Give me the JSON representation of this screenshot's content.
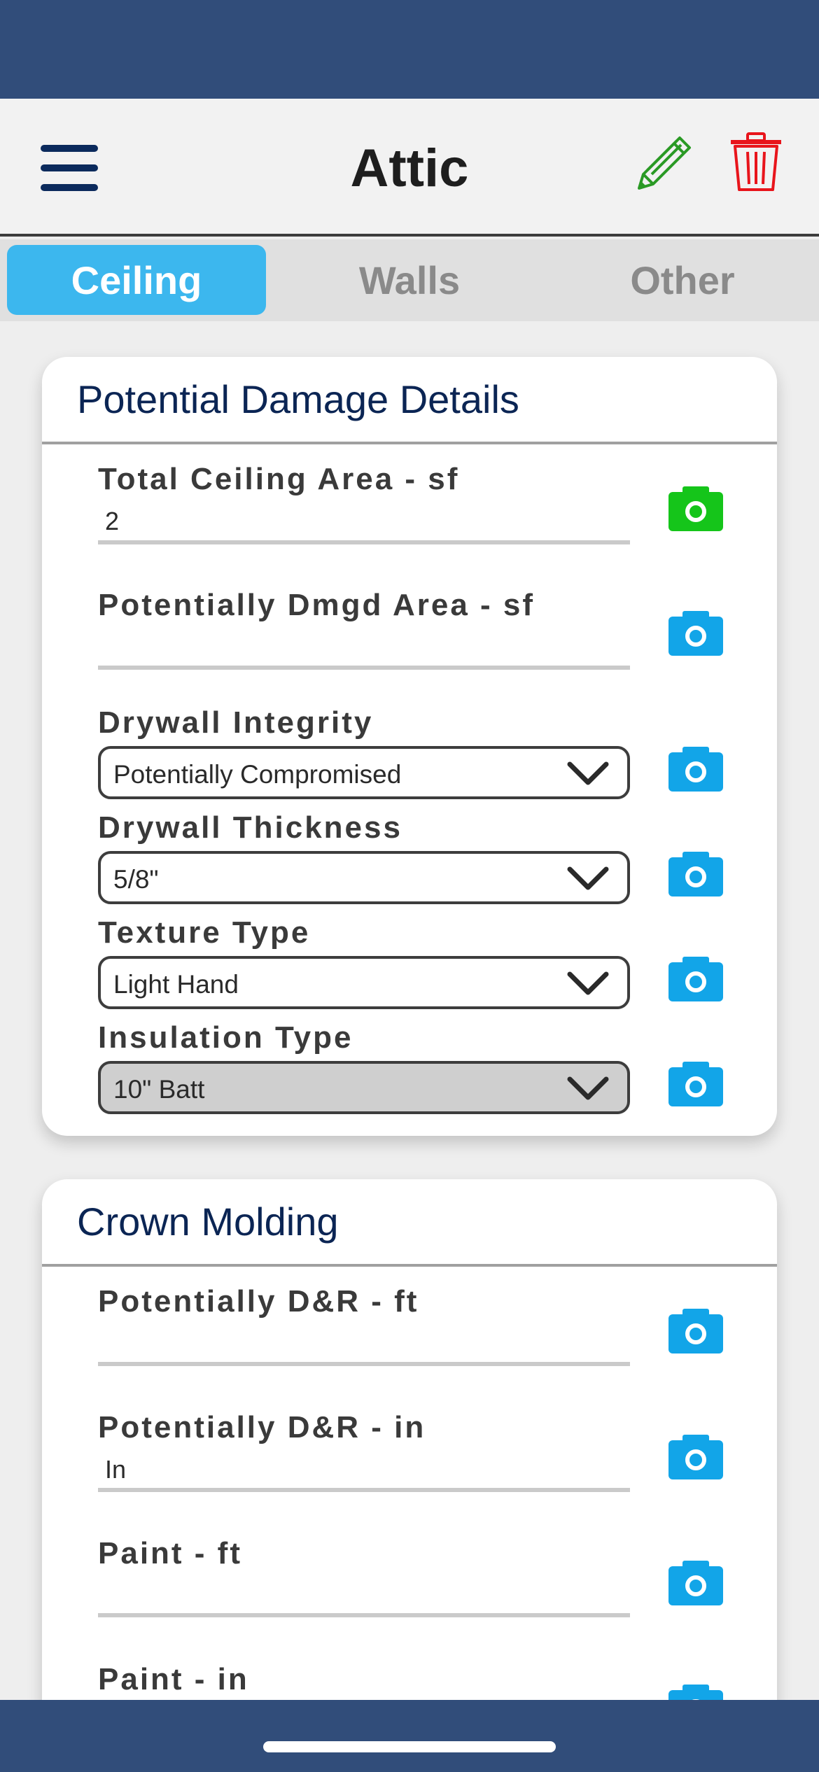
{
  "header": {
    "title": "Attic"
  },
  "tabs": [
    {
      "label": "Ceiling",
      "active": true
    },
    {
      "label": "Walls",
      "active": false
    },
    {
      "label": "Other",
      "active": false
    }
  ],
  "colors": {
    "nav_bar": "#314d7a",
    "active_tab": "#3cb7ee",
    "camera_default": "#12a5e8",
    "camera_active": "#15c51a",
    "edit_icon": "#2a9a25",
    "delete_icon": "#e8141b"
  },
  "icons": {
    "menu": "hamburger-menu-icon",
    "edit": "pencil-icon",
    "delete": "trash-icon",
    "photo": "camera-icon",
    "dropdown": "chevron-down-icon"
  },
  "potential_damage": {
    "title": "Potential Damage Details",
    "fields": {
      "total_ceiling_area": {
        "label": "Total Ceiling Area - sf",
        "value": "2"
      },
      "potentially_dmgd_area": {
        "label": "Potentially Dmgd Area - sf",
        "value": ""
      },
      "drywall_integrity": {
        "label": "Drywall Integrity",
        "value": "Potentially Compromised"
      },
      "drywall_thickness": {
        "label": "Drywall Thickness",
        "value": "5/8\""
      },
      "texture_type": {
        "label": "Texture Type",
        "value": "Light Hand"
      },
      "insulation_type": {
        "label": "Insulation Type",
        "value": "10\" Batt"
      }
    }
  },
  "crown_molding": {
    "title": "Crown Molding",
    "fields": {
      "potentially_dr_ft": {
        "label": "Potentially D&R - ft",
        "value": ""
      },
      "potentially_dr_in": {
        "label": "Potentially D&R - in",
        "value": "In"
      },
      "paint_ft": {
        "label": "Paint - ft",
        "value": ""
      },
      "paint_in": {
        "label": "Paint - in",
        "value": ""
      }
    }
  }
}
